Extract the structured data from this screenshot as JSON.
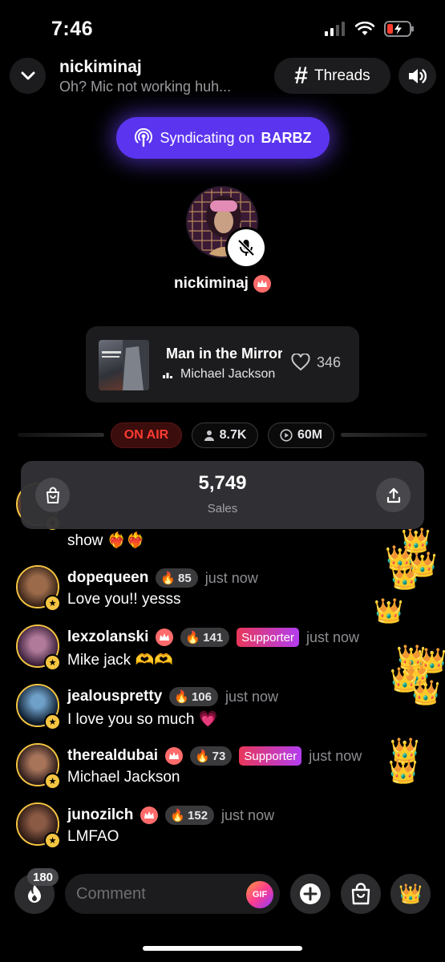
{
  "status_bar": {
    "time": "7:46"
  },
  "header": {
    "host_name": "nickiminaj",
    "room_title": "Oh?  Mic not working huh...",
    "threads_label": "Threads"
  },
  "syndicate": {
    "prefix": "Syndicating on",
    "channel": "BARBZ"
  },
  "host": {
    "name": "nickiminaj"
  },
  "now_playing": {
    "title": "Man in the Mirror",
    "artist": "Michael Jackson",
    "likes": "346"
  },
  "stats": {
    "on_air": "ON AIR",
    "listeners": "8.7K",
    "plays": "60M"
  },
  "sales": {
    "count": "5,749",
    "label": "Sales"
  },
  "partial_comment": {
    "text": "show"
  },
  "comments": [
    {
      "user": "dopequeen",
      "fire": "85",
      "badge": "",
      "time": "just now",
      "text": "Love you!! yesss"
    },
    {
      "user": "lexzolanski",
      "fire": "141",
      "badge": "Supporter",
      "time": "just now",
      "text": "Mike jack"
    },
    {
      "user": "jealouspretty",
      "fire": "106",
      "badge": "",
      "time": "just now",
      "text": "I love you so much"
    },
    {
      "user": "therealdubai",
      "fire": "73",
      "badge": "Supporter",
      "time": "just now",
      "text": "Michael Jackson"
    },
    {
      "user": "junozilch",
      "fire": "152",
      "badge": "",
      "time": "just now",
      "text": "LMFAO"
    }
  ],
  "bottom_bar": {
    "fire_count": "180",
    "comment_placeholder": "Comment",
    "gif_label": "GIF"
  },
  "colors": {
    "accent_purple": "#5b34f0",
    "on_air_red": "#ff3b30",
    "avatar_ring": "#f5c542",
    "supporter_gradient_start": "#e8375a",
    "supporter_gradient_end": "#b33df0"
  }
}
